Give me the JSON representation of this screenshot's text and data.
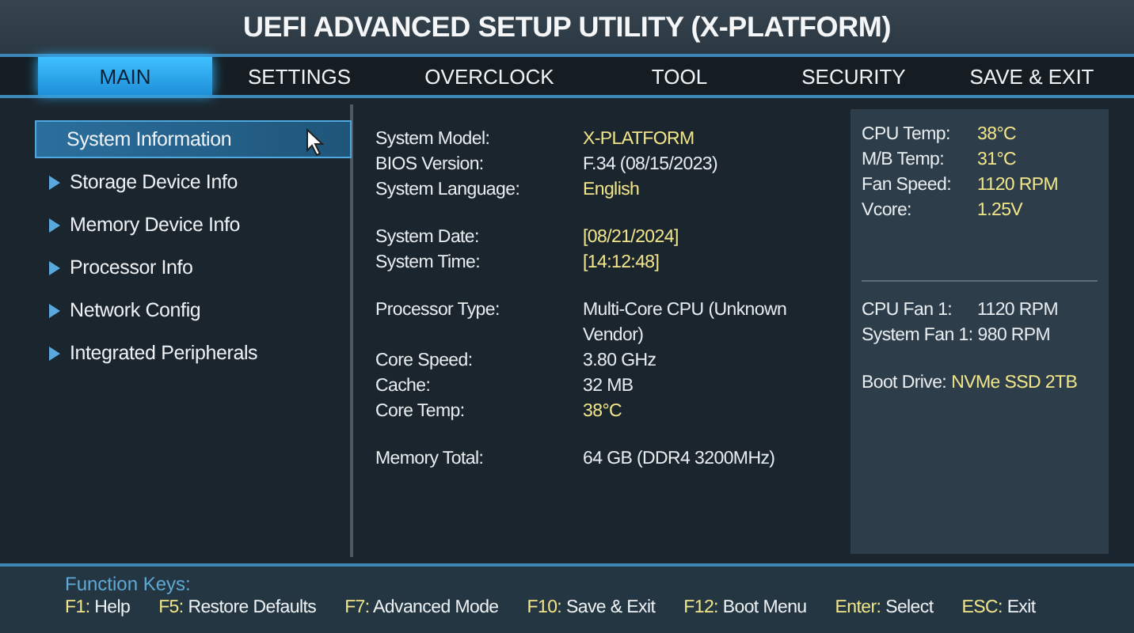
{
  "title": "UEFI ADVANCED SETUP UTILITY (X-PLATFORM)",
  "tabs": [
    {
      "label": "MAIN",
      "selected": true
    },
    {
      "label": "SETTINGS",
      "selected": false
    },
    {
      "label": "OVERCLOCK",
      "selected": false
    },
    {
      "label": "TOOL",
      "selected": false
    },
    {
      "label": "SECURITY",
      "selected": false
    },
    {
      "label": "SAVE & EXIT",
      "selected": false
    }
  ],
  "sidebar": {
    "items": [
      {
        "label": "System Information",
        "selected": true
      },
      {
        "label": "Storage Device Info",
        "selected": false
      },
      {
        "label": "Memory Device Info",
        "selected": false
      },
      {
        "label": "Processor Info",
        "selected": false
      },
      {
        "label": "Network Config",
        "selected": false
      },
      {
        "label": "Integrated Peripherals",
        "selected": false
      }
    ]
  },
  "info_groups": [
    [
      {
        "label": "System Model:",
        "value": "X-PLATFORM",
        "highlight": true
      },
      {
        "label": "BIOS Version:",
        "value": "F.34 (08/15/2023)"
      },
      {
        "label": "System Language:",
        "value": "English",
        "highlight": true
      }
    ],
    [
      {
        "label": "System Date:",
        "value": "[08/21/2024]",
        "highlight": true
      },
      {
        "label": "System Time:",
        "value": "[14:12:48]",
        "highlight": true
      }
    ],
    [
      {
        "label": "Processor Type:",
        "value": "Multi-Core CPU",
        "note": "(Unknown Vendor)"
      },
      {
        "label": "Core Speed:",
        "value": "3.80 GHz"
      },
      {
        "label": "Cache:",
        "value": "32 MB"
      },
      {
        "label": "Core Temp:",
        "value": "38°C",
        "highlight": true
      }
    ],
    [
      {
        "label": "Memory Total:",
        "value": "64 GB (DDR4 3200MHz)"
      }
    ]
  ],
  "monitor": {
    "sensors": [
      {
        "label": "CPU Temp:",
        "value": "38°C",
        "highlight": true
      },
      {
        "label": "M/B Temp:",
        "value": "31°C",
        "highlight": true
      },
      {
        "label": "Fan Speed:",
        "value": "1120 RPM",
        "highlight": true
      },
      {
        "label": "Vcore:",
        "value": "1.25V",
        "highlight": true
      }
    ],
    "fans": [
      {
        "label": "CPU Fan 1:",
        "value": "1120 RPM"
      },
      {
        "label": "System Fan 1:",
        "value": "980 RPM"
      }
    ],
    "boot": {
      "label": "Boot Drive:",
      "value": "NVMe SSD 2TB",
      "highlight": true
    }
  },
  "footer": {
    "title": "Function Keys:",
    "keys": [
      {
        "key": "F1:",
        "action": "Help"
      },
      {
        "key": "F5:",
        "action": "Restore Defaults"
      },
      {
        "key": "F7:",
        "action": "Advanced Mode"
      },
      {
        "key": "F10:",
        "action": "Save & Exit"
      },
      {
        "key": "F12:",
        "action": "Boot Menu"
      },
      {
        "key": "Enter:",
        "action": "Select"
      },
      {
        "key": "ESC:",
        "action": "Exit"
      }
    ]
  }
}
